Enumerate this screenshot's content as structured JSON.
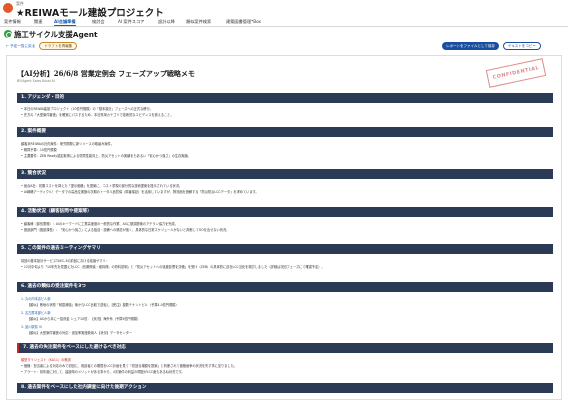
{
  "header": {
    "breadcrumb_small": "案件",
    "title": "★REIWAモール建設プロジェクト"
  },
  "tabs": [
    {
      "label": "案件情報"
    },
    {
      "label": "関連"
    },
    {
      "label": "AI会議準備"
    },
    {
      "label": "検討会"
    },
    {
      "label": "AI 案件スコア"
    },
    {
      "label": "設計以降"
    },
    {
      "label": "類似案件検索"
    },
    {
      "label": "建築図書管理*Box"
    }
  ],
  "page": {
    "heading": "施工サイクル支援Agent"
  },
  "toolbar": {
    "back_label": "← 予定一覧に戻る",
    "draft_label": "ドラフトを再編集",
    "save_report_label": "レポートをファイルとして保存",
    "copy_text_label": "テキストをコピー"
  },
  "document": {
    "title": "【AI分析】26/6/8 営業定例会 フェーズアップ戦略メモ",
    "subtitle": "BY(Agent Sales Kusai AI",
    "stamp": "CONFIDENTIAL",
    "sections": [
      {
        "heading": "1. アジェンダ・目的",
        "lines": [
          "• 本日のREIWA建設プロジェクト（10億円規模）の「基本設計」フェーズへの正式な移行。",
          "• 先方の「大型案件審査」を確実にパスするため、本社専用カテゴリで技術的なエビデンスを揃えること。"
        ]
      },
      {
        "heading": "2. 案件概要",
        "lines": [
          "顧客未REIWAの社内案件：研究開発に新リリースの取組み案件。",
          "• 概算予算：10億円規模",
          "• 主要要件：ZEB Ready認定取得による環境性能向上、防災アセットの実績をもあるい「安心かつ強さ」の生存実績。"
        ]
      },
      {
        "heading": "3. 競合状況",
        "lines": [
          "• 競合A社：初期コストを抑えた「提示価格」を提案に、コスト重視の部分的な技術提案を提示されている状況。",
          "• AI戦略アーティクル！データでの高品位実施の次期のトータル品質保（障害保証）を活用していますが、物流面を読解する「防災防災LCCデータ」を求めています。"
        ]
      },
      {
        "heading": "4. 活動状況（顧客訪問や提案等）",
        "lines": [
          "• 顧客様（部長業務）：AIのキーワードに工業高速度の一般的な作業、ASに基調提案のアテラン協力を完成。",
          "• 施設部門（施設課長）：「安心かつ強さ」による独自・設備への懸念が強く、具体的な日常スケジュールがないと判断してGOを出せない状況。"
        ]
      },
      {
        "heading": "5. この案件の過去ミーティングサマリ",
        "lines": [
          "前回の基本設計サービスTAEC-3の前回における議論サマリ：",
          "• 12月中旬より「10年先を見据えたLCC（長期修繕・維持費）の資料説明」と「防災アセットへの強度影響を評価」を受け（ZEB）の具体的に自社LCC当化を検討しました（詳細は次回フェーズにて確認予定）。"
        ]
      },
      {
        "heading": "6. 過去の類似の受注案件を3つ",
        "items": [
          {
            "name": "1. 丸の内本店ビル新",
            "detail": "【類似】敷地の状態「耐震補強」案からLCC比較で逆転し【受注】複数テナントビル（予算4.0億円規模）"
          },
          {
            "name": "2. 名古屋本部ビル新",
            "detail": "【類似】ASから本に一括資金 シェア10億：【状況】海外系（予算5億円規模）"
          },
          {
            "name": "3. 品川駅前 III",
            "detail": "【類似】大型案件審査の対応・追加率実施費用人【状況】データセンター"
          }
        ]
      },
      {
        "heading": "7. 過去の失注案件をベースにした避けるべき対応",
        "warn": "類型ダイジェスト（KA11）の教訓",
        "lines": [
          "• 価格：担当者による対応のみで初回に、相談者との期間をLCC計画を見て「初回る増額を提案」と判断されて価格競争の状況を失す事に至りました。",
          "• アラート：前年度に対して、建設時のメリットがある事から、4次案件の利益の問題がLCC面もあるね状況です。"
        ]
      },
      {
        "heading": "8. 過去案件をベースにした社内調査に向けた後期アクション",
        "lines": []
      }
    ]
  },
  "colors": {
    "accent": "#1a5fb4",
    "section_bar": "#2b3a55",
    "app_icon": "#e0592a",
    "agent_icon": "#2ea043",
    "stamp": "#e08b8b",
    "warning": "#c62828"
  }
}
